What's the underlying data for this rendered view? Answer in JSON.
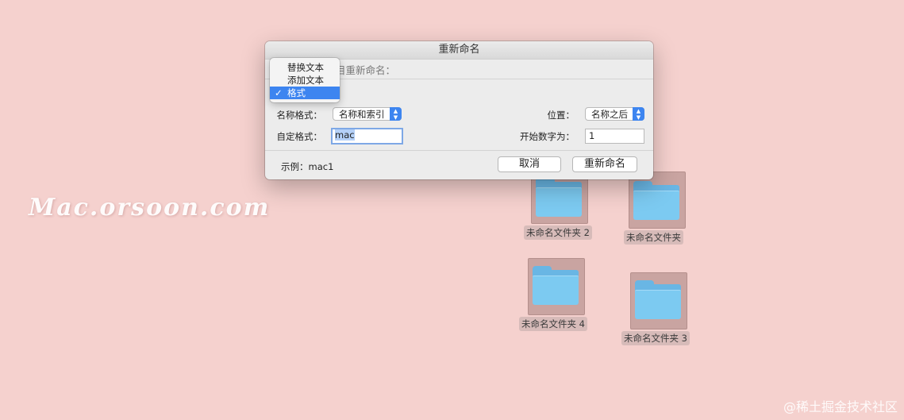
{
  "dialog": {
    "title": "重新命名",
    "subtitle": "目重新命名：",
    "name_format_label": "名称格式：",
    "name_format_value": "名称和索引",
    "custom_format_label": "自定格式：",
    "custom_format_value": "mac",
    "position_label": "位置：",
    "position_value": "名称之后",
    "start_number_label": "开始数字为：",
    "start_number_value": "1",
    "example_label": "示例：",
    "example_value": "mac1",
    "cancel_label": "取消",
    "rename_label": "重新命名",
    "popup_arrows": "▲\n▼"
  },
  "mode_menu": {
    "items": [
      {
        "label": "替换文本",
        "checked": false
      },
      {
        "label": "添加文本",
        "checked": false
      },
      {
        "label": "格式",
        "checked": true
      }
    ],
    "check_glyph": "✓"
  },
  "desktop": {
    "folders": [
      {
        "label": "未命名文件夹 2"
      },
      {
        "label": "未命名文件夹"
      },
      {
        "label": "未命名文件夹 4"
      },
      {
        "label": "未命名文件夹 3"
      }
    ]
  },
  "watermark": "Mac.orsoon.com",
  "credit": "@稀土掘金技术社区",
  "colors": {
    "desktop_bg": "#f5d1ce",
    "accent": "#3d85f0",
    "folder_blue": "#7ccaf1",
    "selection": "#c9a4a1"
  }
}
